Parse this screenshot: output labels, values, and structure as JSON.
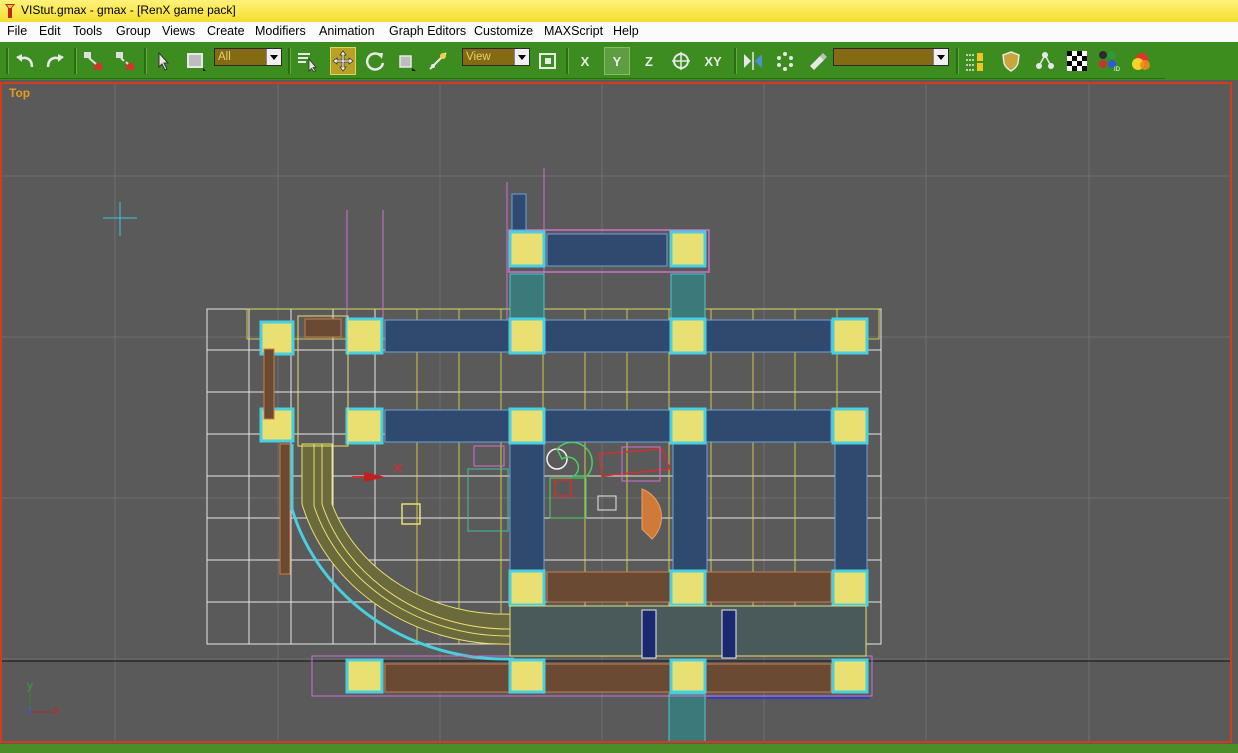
{
  "window": {
    "title": "VIStut.gmax - gmax - [RenX game pack]"
  },
  "menu": [
    "File",
    "Edit",
    "Tools",
    "Group",
    "Views",
    "Create",
    "Modifiers",
    "Animation",
    "Graph Editors",
    "Customize",
    "MAXScript",
    "Help"
  ],
  "toolbar": {
    "selection_filter": "All",
    "reference_coord": "View",
    "named_selection": "",
    "axis_x": "X",
    "axis_y": "Y",
    "axis_z": "Z",
    "axis_xy": "XY"
  },
  "viewport": {
    "label": "Top"
  },
  "axis_tripod": {
    "y": "y",
    "z": "z",
    "x": "x"
  },
  "colors": {
    "title_bar": "#f4de2e",
    "toolbar": "#3d8c1f",
    "active_viewport_border": "#d33c1a",
    "viewport_bg": "#5a5a5a",
    "viewport_label": "#e69b1e"
  }
}
